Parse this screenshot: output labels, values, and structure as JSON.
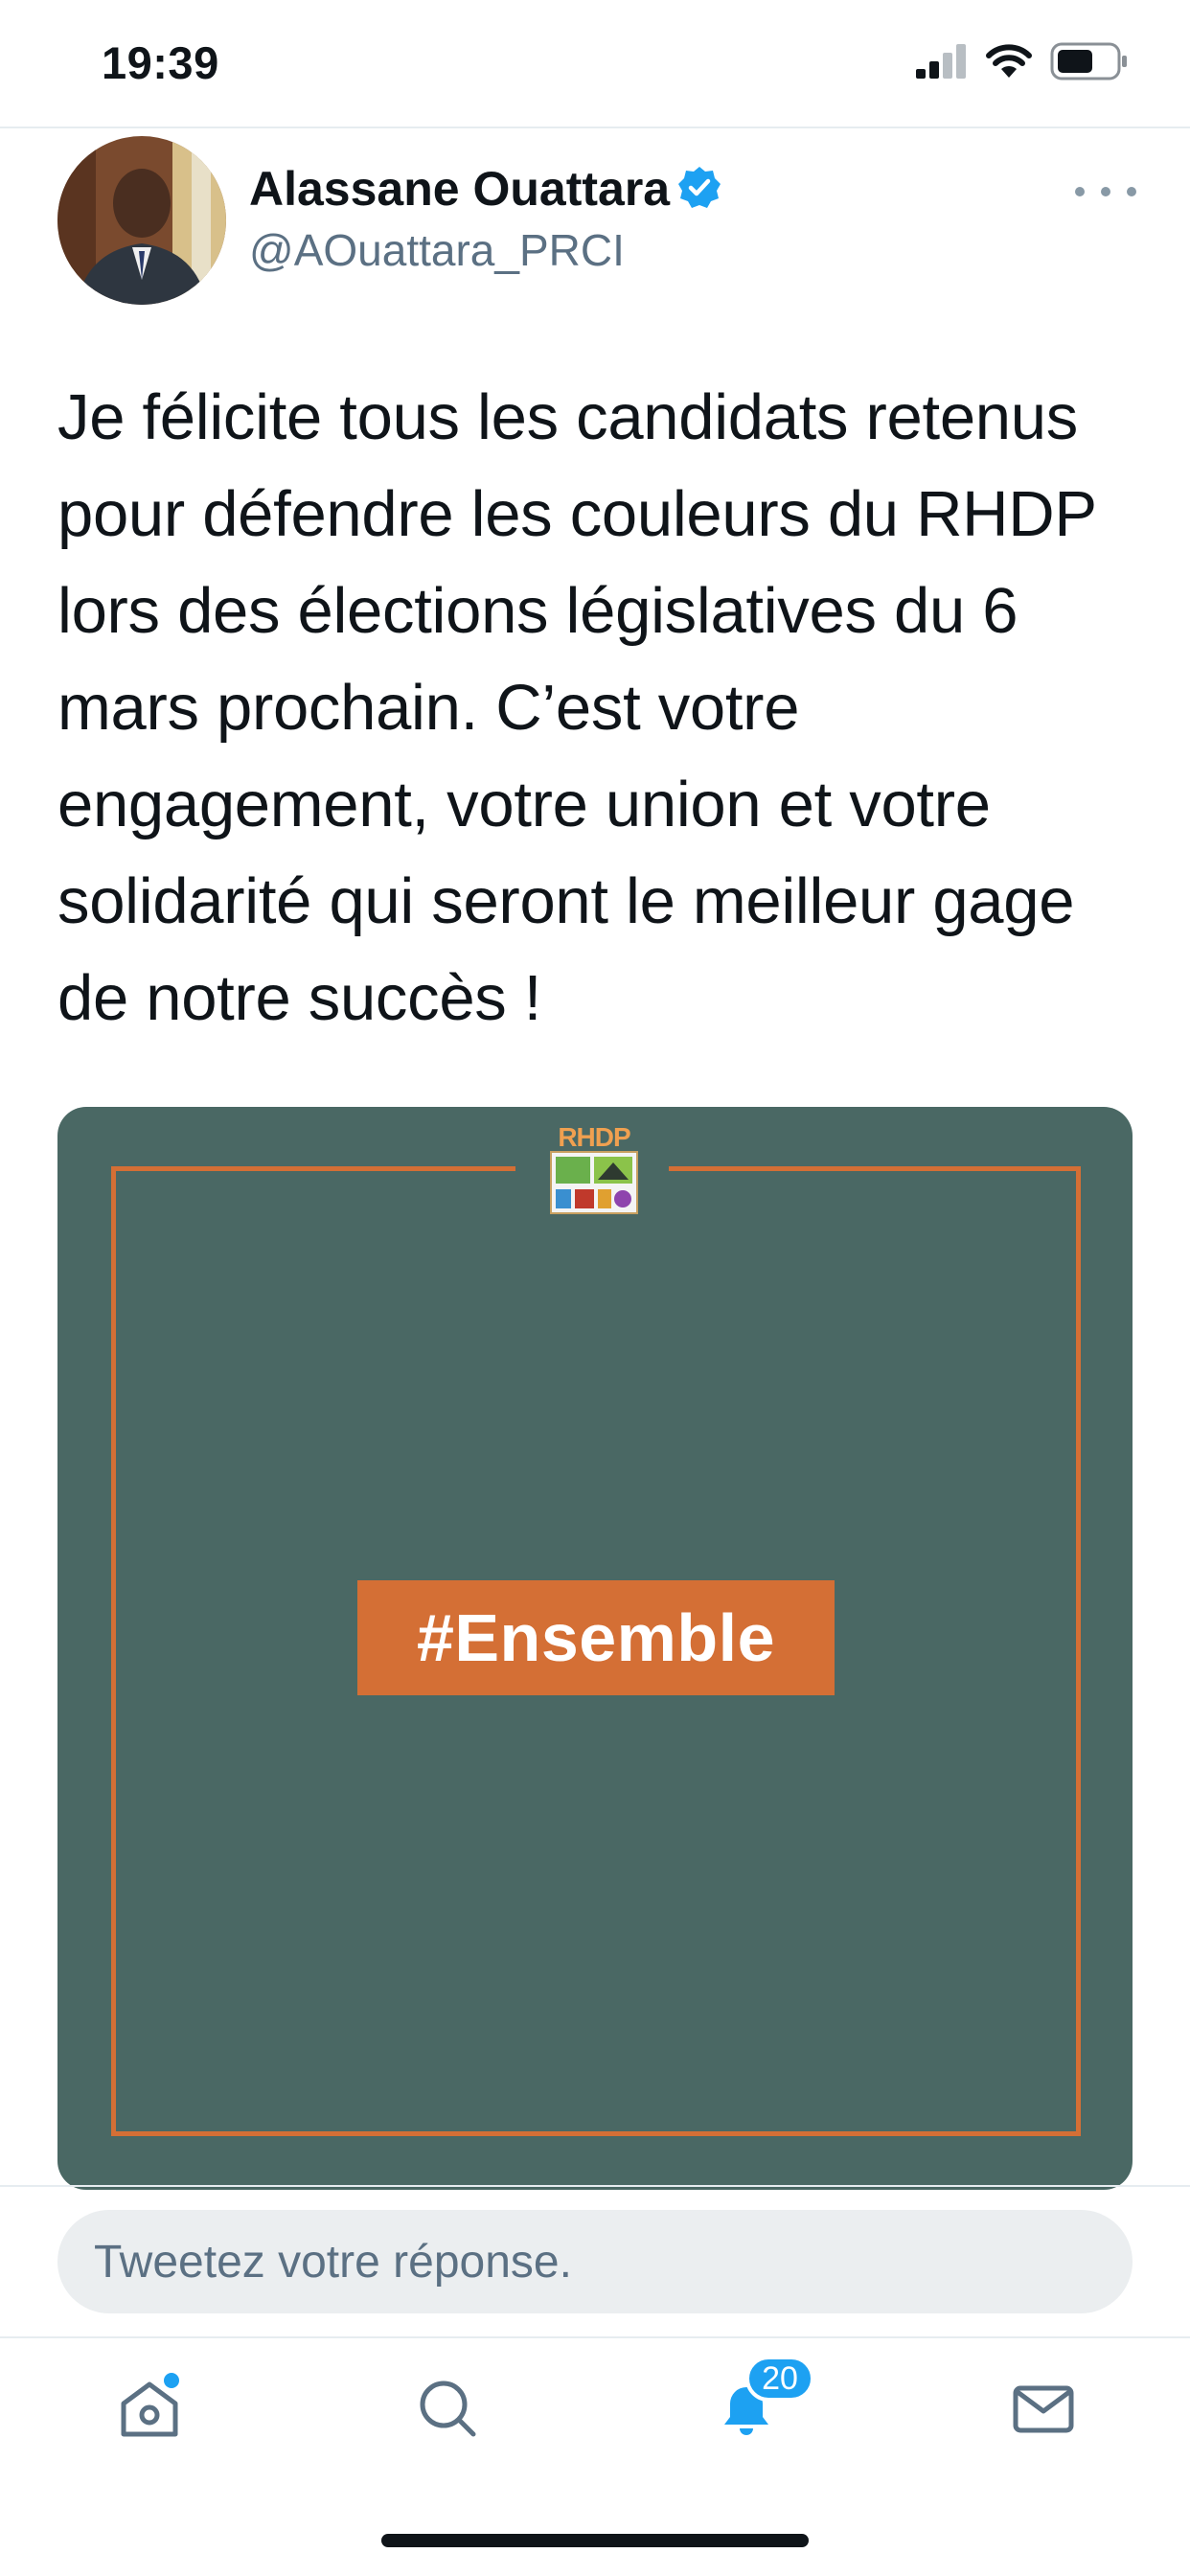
{
  "status_bar": {
    "time": "19:39",
    "icons": [
      "cellular-signal-icon",
      "wifi-icon",
      "battery-icon"
    ]
  },
  "tweet": {
    "author": {
      "name": "Alassane Ouattara",
      "handle": "@AOuattara_PRCI",
      "verified": true
    },
    "text": "Je félicite tous les candidats retenus pour défendre les couleurs du RHDP lors des élections législatives du 6 mars prochain. C’est votre engagement, votre union et votre solidarité qui seront le meilleur gage de notre succès !",
    "media": {
      "logo_text": "RHDP",
      "hashtag": "#Ensemble",
      "background_color": "#4a6864",
      "accent_color": "#d46f35"
    }
  },
  "reply": {
    "placeholder": "Tweetez votre réponse."
  },
  "tab_bar": {
    "tabs": [
      {
        "name": "home",
        "icon": "home-icon",
        "has_dot": true
      },
      {
        "name": "search",
        "icon": "search-icon"
      },
      {
        "name": "notifications",
        "icon": "bell-icon",
        "badge": "20"
      },
      {
        "name": "messages",
        "icon": "mail-icon"
      }
    ]
  },
  "colors": {
    "accent": "#1da1f2",
    "text_primary": "#0f1419",
    "text_secondary": "#5b7083"
  }
}
